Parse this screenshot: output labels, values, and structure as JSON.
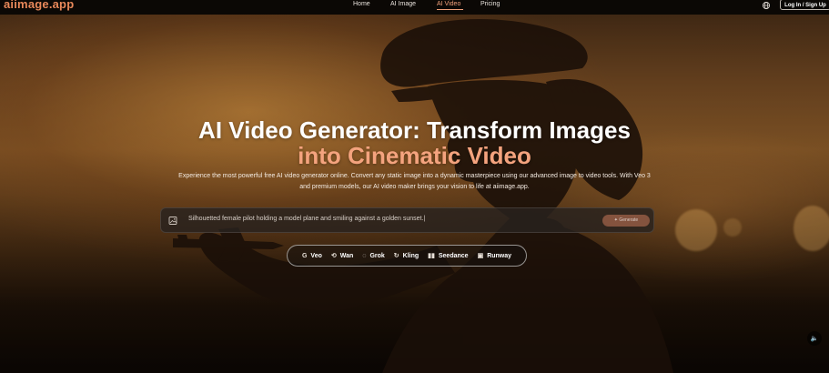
{
  "brand": {
    "logo_text": "aiimage.app"
  },
  "nav": {
    "items": [
      {
        "label": "Home",
        "active": false
      },
      {
        "label": "AI Image",
        "active": false
      },
      {
        "label": "AI Video",
        "active": true
      },
      {
        "label": "Pricing",
        "active": false
      }
    ],
    "login_label": "Log In / Sign Up",
    "globe_icon": "globe-icon"
  },
  "hero": {
    "title_line1": "AI Video Generator: Transform Images",
    "title_line2": "into Cinematic Video",
    "subtitle": "Experience the most powerful free AI video generator online. Convert any static image into a dynamic masterpiece using our advanced image to video tools. With Veo 3 and premium models, our AI video maker brings your vision to life at aiimage.app."
  },
  "prompt": {
    "value": "Silhouetted female pilot holding a model plane and smiling against a golden sunset.|",
    "upload_icon": "image-upload-icon",
    "generate_label": "Generate"
  },
  "models": [
    {
      "glyph": "G",
      "label": "Veo"
    },
    {
      "glyph": "⟲",
      "label": "Wan"
    },
    {
      "glyph": "◌",
      "label": "Grok"
    },
    {
      "glyph": "↻",
      "label": "Kling"
    },
    {
      "glyph": "▮▮",
      "label": "Seedance"
    },
    {
      "glyph": "▣",
      "label": "Runway"
    }
  ],
  "colors": {
    "brand": "#e8885a",
    "accent": "#f4a37e",
    "topbar_bg": "#0b0805"
  }
}
